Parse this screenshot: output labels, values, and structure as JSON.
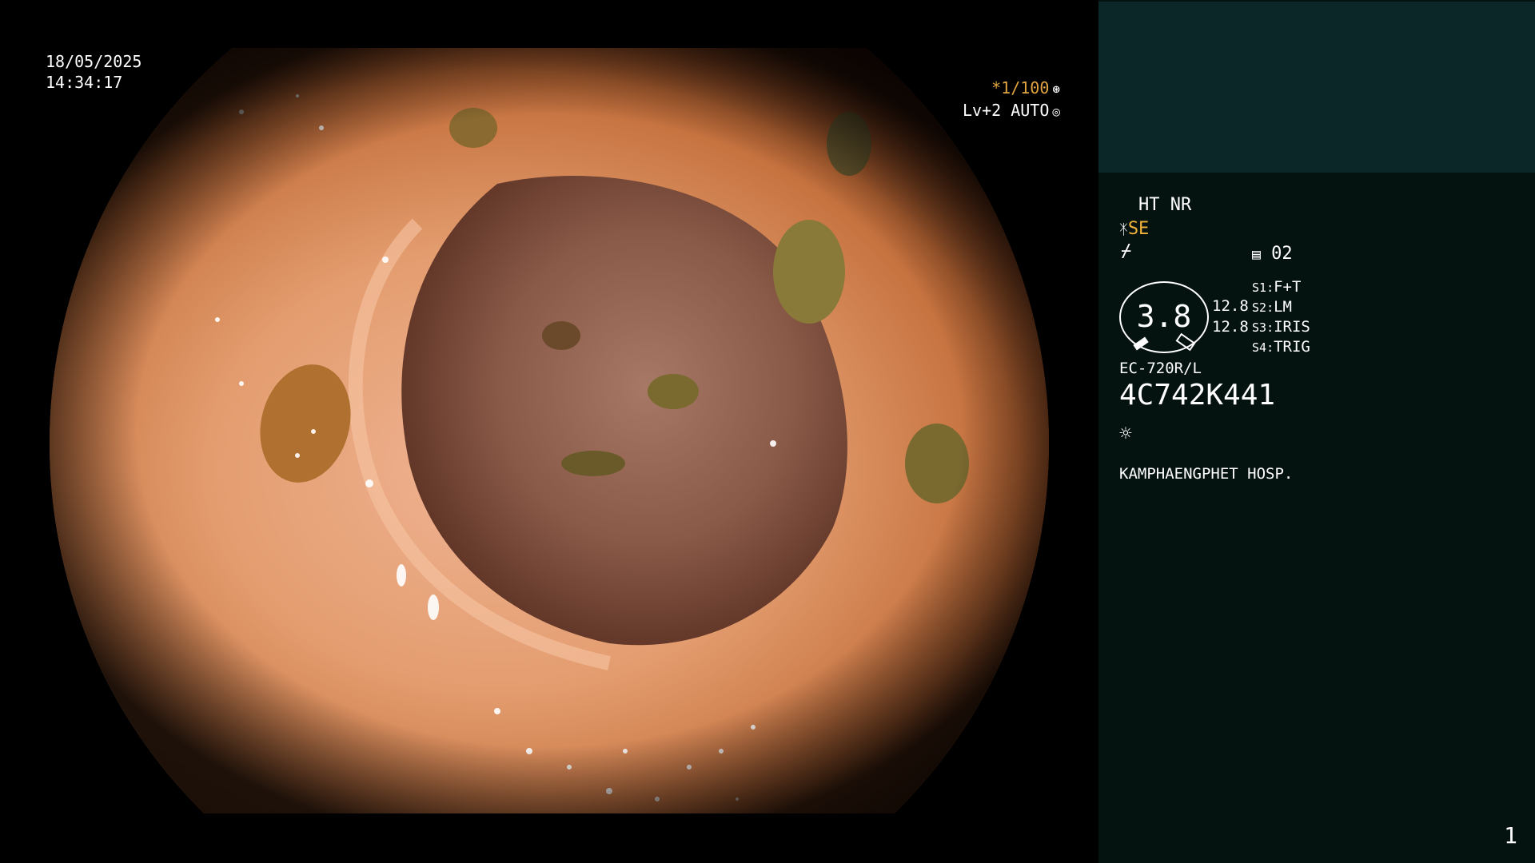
{
  "overlay": {
    "date": "18/05/2025",
    "time": "14:34:17",
    "shutter": "*1/100",
    "level": "Lv+2 AUTO",
    "shutter_icon": "aperture-icon",
    "level_icon": "auto-iris-icon"
  },
  "panel": {
    "modes": "HT NR",
    "enhance": "SE",
    "enhance_icon": "edge-enhance-icon",
    "filter_icon": "filter-icon",
    "memo_value": "02",
    "memo_icon": "memo-icon",
    "gauge_value": "3.8",
    "readout_top": "12.8",
    "readout_bottom": "12.8",
    "switches": [
      {
        "key": "S1",
        "sep": ":",
        "value": "F+T"
      },
      {
        "key": "S2",
        "sep": ":",
        "value": "LM"
      },
      {
        "key": "S3",
        "sep": ":",
        "value": "IRIS"
      },
      {
        "key": "S4",
        "sep": ":",
        "value": "TRIG"
      }
    ],
    "scope_model": "EC-720R/L",
    "serial": "4C742K441",
    "light_icon": "sun-icon",
    "hospital": "KAMPHAENGPHET HOSP.",
    "page_number": "1"
  },
  "colors": {
    "panel_bg": "#041210",
    "panel_top": "#0c2727",
    "accent": "#f2b33c",
    "tissue": "#e39c6e"
  }
}
